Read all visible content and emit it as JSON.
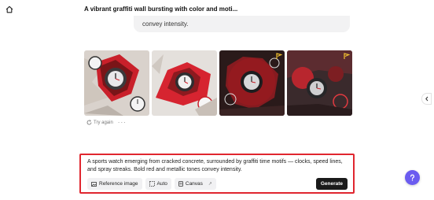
{
  "header": {
    "title": "A vibrant graffiti wall bursting with color and moti...",
    "home_icon": "home-icon"
  },
  "previous_message": {
    "text": "convey intensity."
  },
  "results": {
    "images": [
      {
        "description_icon": "image-1"
      },
      {
        "description_icon": "image-2"
      },
      {
        "description_icon": "image-3",
        "flag_icon": "flag-icon"
      },
      {
        "description_icon": "image-4",
        "flag_icon": "flag-icon"
      }
    ],
    "try_again_label": "Try again",
    "more_label": "···"
  },
  "prompt": {
    "text": "A sports watch emerging from cracked concrete, surrounded by graffiti time motifs — clocks, speed lines, and spray streaks. Bold red and metallic tones convey intensity.",
    "highlight_color": "#e0262f",
    "tools": {
      "reference_image_label": "Reference image",
      "auto_label": "Auto",
      "canvas_label": "Canvas",
      "canvas_ext": "↗"
    },
    "generate_label": "Generate"
  },
  "help": {
    "icon": "help-icon",
    "color": "#6b5cf0"
  }
}
